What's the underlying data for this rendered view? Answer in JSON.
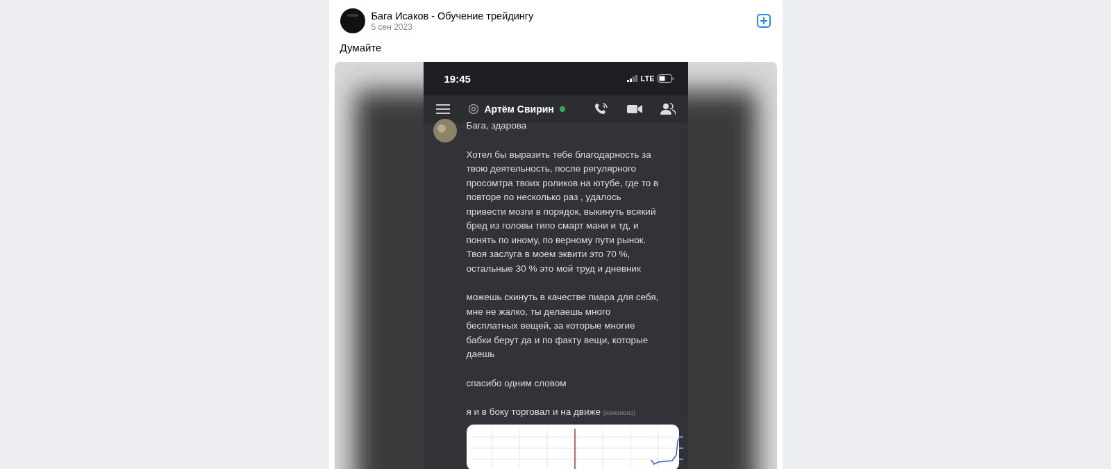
{
  "post": {
    "author": "Бага Исаков - Обучение трейдингу",
    "date": "5 сен 2023",
    "text": "Думайте"
  },
  "screenshot": {
    "time": "19:45",
    "network": "LTE",
    "chat_title": "Артём Свирин",
    "online": true,
    "messages": [
      "Бага, здарова",
      "Хотел бы выразить тебе благодарность за\nтвою деятельность, после регулярного\nпросомтра твоих роликов на ютубе, где то в\nповторе по несколько раз , удалось\nпривести мозги в порядок, выкинуть всякий\nбред  из головы  типо смарт мани и тд, и\nпонять по иному, по верному пути рынок.\nТвоя заслуга в моем эквити это 70 %,\nостальные 30 % это мой труд и дневник",
      "можешь скинуть в качестве пиара для себя,\nмне не жалко, ты делаешь много\nбесплатных вещей, за которые многие\nбабки берут да и по факту вещи, которые\nдаешь",
      "спасибо одним словом"
    ],
    "last_message": {
      "text": "я и в боку торговал и на движе",
      "edited": "(изменено)"
    }
  }
}
